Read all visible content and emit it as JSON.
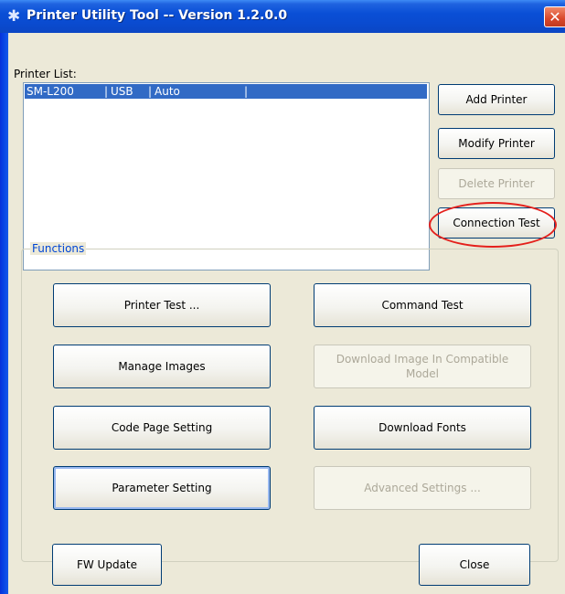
{
  "window": {
    "title": "Printer Utility Tool -- Version 1.2.0.0",
    "icon": "gear-icon",
    "close_glyph": "✕"
  },
  "printer_list": {
    "label": "Printer List:",
    "rows": [
      {
        "name": "SM-L200",
        "sep1": "|",
        "interface": "USB",
        "sep2": "|",
        "mode": "Auto",
        "sep3": "|"
      }
    ]
  },
  "side_buttons": {
    "add": "Add Printer",
    "modify": "Modify Printer",
    "delete": "Delete Printer",
    "connection_test": "Connection Test"
  },
  "functions": {
    "title": "Functions",
    "printer_test": "Printer Test ...",
    "command_test": "Command Test",
    "manage_images": "Manage Images",
    "download_image": "Download Image In Compatible Model",
    "code_page": "Code Page Setting",
    "download_fonts": "Download Fonts",
    "parameter_setting": "Parameter Setting",
    "advanced_settings": "Advanced Settings ..."
  },
  "bottom": {
    "fw_update": "FW Update",
    "close": "Close"
  },
  "colors": {
    "title_bar": "#0a4fd6",
    "selection": "#316ac5",
    "group_title": "#0046d5",
    "annotation": "#e4201c",
    "disabled_text": "#aca899"
  }
}
